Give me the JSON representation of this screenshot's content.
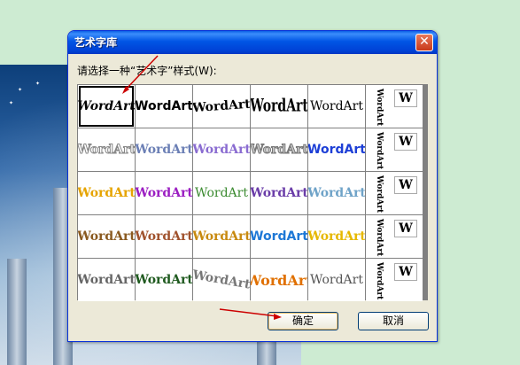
{
  "dialog": {
    "title": "艺术字库",
    "close_symbol": "✕",
    "prompt": "请选择一种“艺术字”样式(W):",
    "ok_label": "确定",
    "cancel_label": "取消"
  },
  "gallery": {
    "selected_index": 0,
    "style_text": "WordArt",
    "vertical_text": "WordArt",
    "side_letter": "W"
  },
  "colors": {
    "title_start": "#0a5fe6",
    "title_end": "#0036c2",
    "dialog_bg": "#ece9d8",
    "desktop_bg": "#cdebd2",
    "arrow": "#cc0000"
  }
}
